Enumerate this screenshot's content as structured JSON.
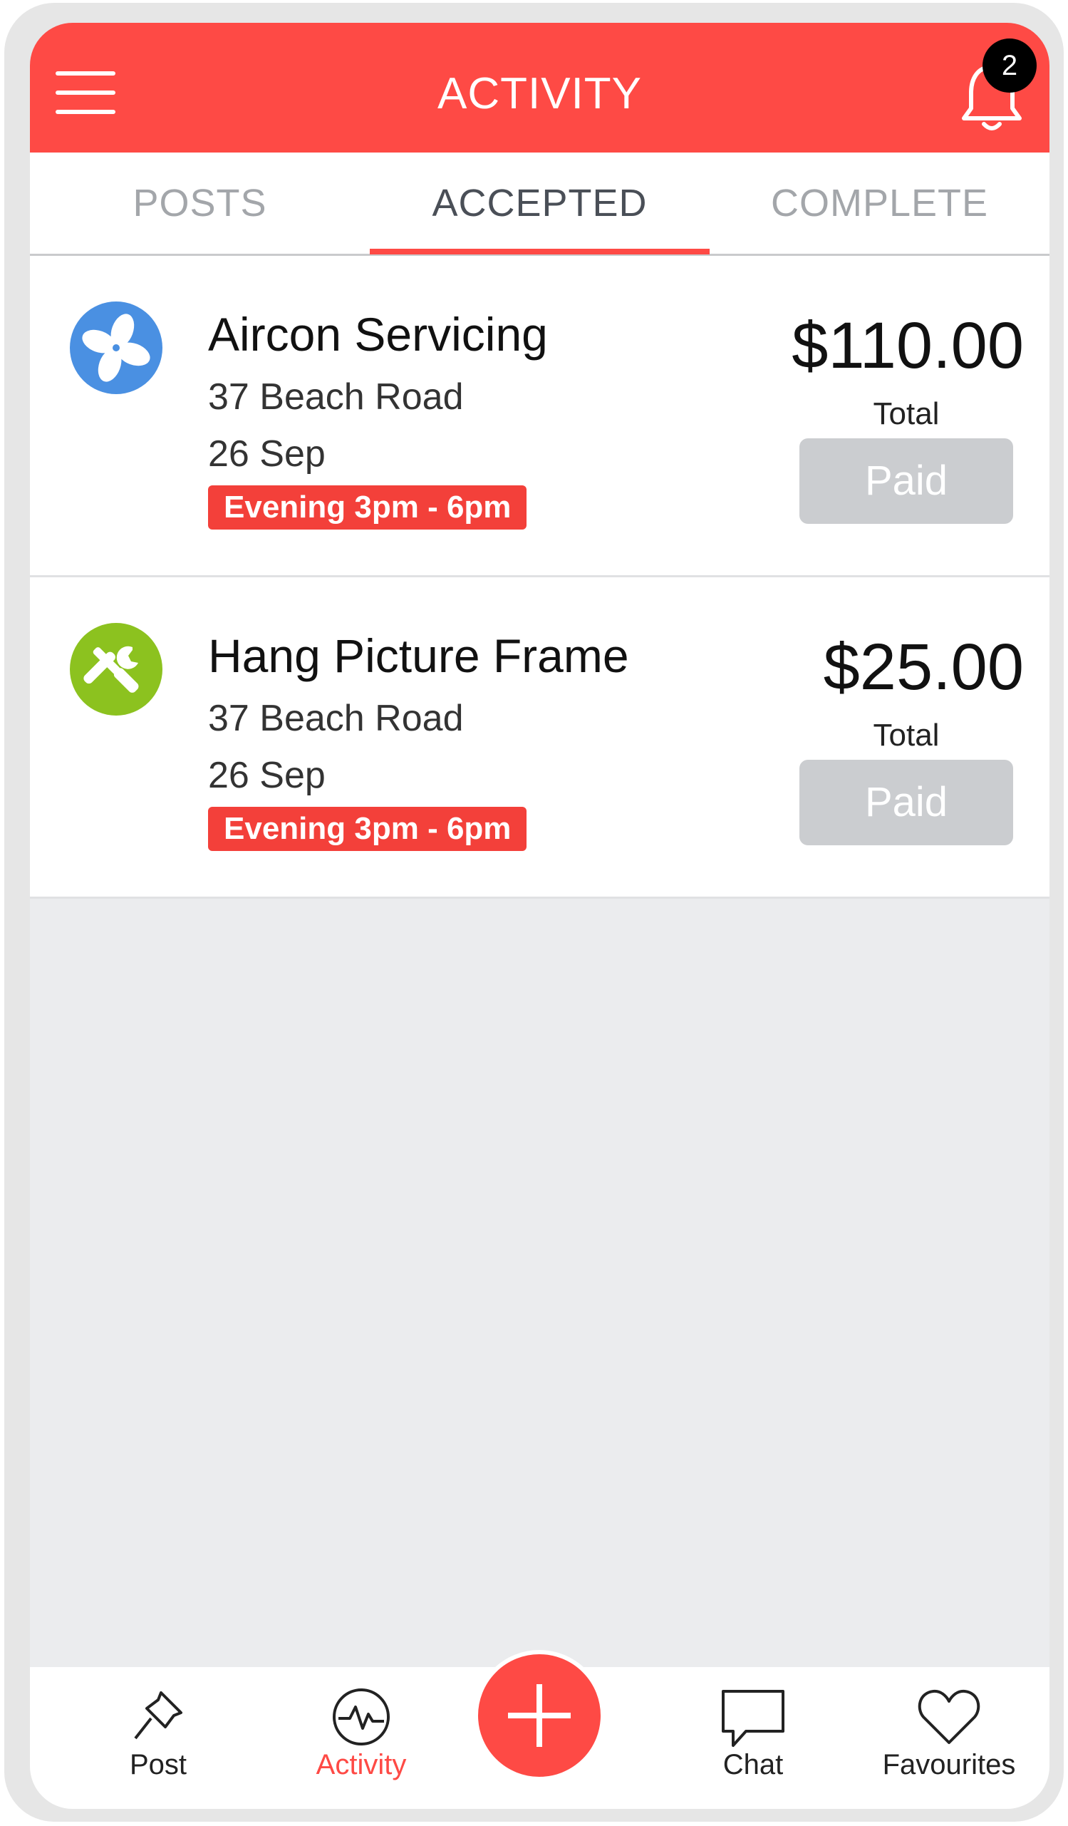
{
  "header": {
    "title": "ACTIVITY",
    "notification_count": "2"
  },
  "tabs": [
    {
      "label": "POSTS",
      "active": false
    },
    {
      "label": "ACCEPTED",
      "active": true
    },
    {
      "label": "COMPLETE",
      "active": false
    }
  ],
  "jobs": [
    {
      "icon": "fan-icon",
      "icon_color": "#4a90e2",
      "title": "Aircon Servicing",
      "address": "37 Beach Road",
      "date": "26 Sep",
      "time_slot": "Evening 3pm - 6pm",
      "amount": "$110.00",
      "total_label": "Total",
      "status_button": "Paid"
    },
    {
      "icon": "tools-icon",
      "icon_color": "#8cc21f",
      "title": "Hang Picture Frame",
      "address": "37 Beach Road",
      "date": "26 Sep",
      "time_slot": "Evening 3pm - 6pm",
      "amount": "$25.00",
      "total_label": "Total",
      "status_button": "Paid"
    }
  ],
  "bottom_nav": [
    {
      "label": "Post",
      "icon": "pin-icon",
      "active": false
    },
    {
      "label": "Activity",
      "icon": "activity-icon",
      "active": true
    },
    {
      "label": "",
      "icon": "plus-icon",
      "active": false
    },
    {
      "label": "Chat",
      "icon": "chat-icon",
      "active": false
    },
    {
      "label": "Favourites",
      "icon": "heart-icon",
      "active": false
    }
  ],
  "colors": {
    "accent": "#fe4a45",
    "badge_red": "#f3403a",
    "paid_gray": "#cbcdd0",
    "background": "#ebecee"
  }
}
